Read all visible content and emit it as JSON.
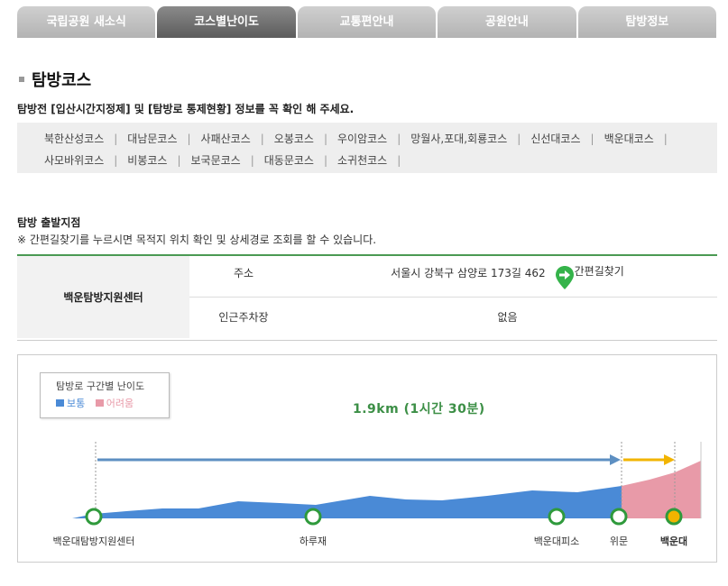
{
  "tabs": [
    {
      "label": "국립공원 새소식",
      "active": false
    },
    {
      "label": "코스별난이도",
      "active": true
    },
    {
      "label": "교통편안내",
      "active": false
    },
    {
      "label": "공원안내",
      "active": false
    },
    {
      "label": "탐방정보",
      "active": false
    }
  ],
  "page_title": "탐방코스",
  "notice": "탐방전 [입산시간지정제] 및 [탐방로 통제현황] 정보를 꼭 확인 해 주세요.",
  "courses": {
    "line1": [
      "북한산성코스",
      "대남문코스",
      "사패산코스",
      "오봉코스",
      "우이암코스",
      "망월사,포대,회룡코스",
      "신선대코스",
      "백운대코스"
    ],
    "line2": [
      "사모바위코스",
      "비봉코스",
      "보국문코스",
      "대동문코스",
      "소귀천코스"
    ]
  },
  "start": {
    "title": "탐방 출발지점",
    "desc": "※ 간편길찾기를 누르시면 목적지 위치 확인 및 상세경로 조회를 할 수 있습니다.",
    "place_name": "백운탐방지원센터",
    "address_label": "주소",
    "address_value": "서울시 강북구 삼양로 173길 462",
    "nav_label": "간편길찾기",
    "parking_label": "인근주차장",
    "parking_value": "없음"
  },
  "legend": {
    "title": "탐방로 구간별 난이도",
    "normal": "보통",
    "hard": "어려움"
  },
  "colors": {
    "normal": "#4a8ad6",
    "hard": "#e89aa8",
    "accent_green": "#3c8f46",
    "arrow_yellow": "#f2b400"
  },
  "chart_data": {
    "type": "area",
    "distance_label": "1.9km (1시간 30분)",
    "segments": [
      {
        "name": "보통",
        "from": "백운대탐방지원센터",
        "to": "위문"
      },
      {
        "name": "어려움",
        "from": "위문",
        "to": "백운대"
      }
    ],
    "waypoints": [
      {
        "name": "백운대탐방지원센터",
        "highlight": false
      },
      {
        "name": "하루재",
        "highlight": false
      },
      {
        "name": "백운대피소",
        "highlight": false
      },
      {
        "name": "위문",
        "highlight": false
      },
      {
        "name": "백운대",
        "highlight": true
      }
    ]
  }
}
